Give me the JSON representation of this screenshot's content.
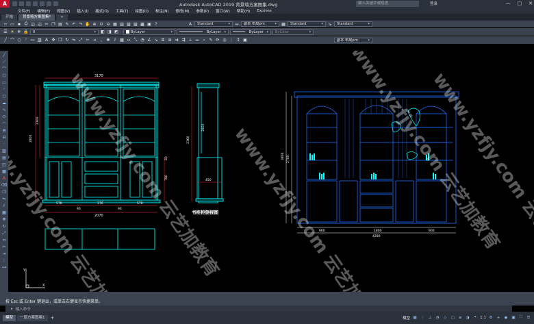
{
  "titlebar": {
    "logo": "A",
    "title": "Autodesk AutoCAD 2019    背景墙方案图集.dwg",
    "search_placeholder": "键入关键字或短语",
    "login": "登录",
    "minimize": "—",
    "maximize": "□",
    "close": "✕"
  },
  "menu": [
    "文件(F)",
    "编辑(E)",
    "视图(V)",
    "插入(I)",
    "格式(O)",
    "工具(T)",
    "绘图(D)",
    "标注(N)",
    "修改(M)",
    "参数(P)",
    "窗口(W)",
    "帮助(H)",
    "Express"
  ],
  "doc_tabs": [
    {
      "label": "开始",
      "active": false
    },
    {
      "label": "背景墙方案图集*",
      "active": true
    },
    {
      "label": "+",
      "active": false
    }
  ],
  "toolbar1": {
    "text_style": "Standard",
    "dim_layer": "副本 布局pm",
    "table_style": "Standard",
    "mleader_style": "Standard"
  },
  "toolbar2": {
    "layer_name": "0",
    "color": "ByLayer",
    "linetype": "ByLayer",
    "lineweight": "ByLayer",
    "plot_style": "ByColor"
  },
  "toolbar3": {
    "dim_style": "副本 布局pm"
  },
  "drawing": {
    "side_title": "书柜柜侧视图",
    "front_top_dim": "3170",
    "front_bottom_dims": [
      "570",
      "90",
      "376",
      "90",
      "570"
    ],
    "front_total_dim": "2070",
    "front_height_dims": [
      "2800",
      "2300",
      "780",
      "80"
    ],
    "side_height_dims": [
      "2360",
      "2800"
    ],
    "side_width_dim": "450",
    "right_height_dims": [
      "3800",
      "2700"
    ],
    "right_bottom_dims": [
      "900",
      "1800",
      "900"
    ],
    "right_total_dim": "4280"
  },
  "command": {
    "hint": "按 Esc 或 Enter 键退出，或单击右键显示快捷菜单。",
    "placeholder": "键入命令"
  },
  "layout_tabs": [
    {
      "label": "模型",
      "active": true
    },
    {
      "label": "一层方案图案1",
      "active": false
    }
  ],
  "status": {
    "model": "模型",
    "scale": "1:1"
  },
  "watermark": "www.yzfjy.com 云艺加教育",
  "colors": {
    "cyan": "#00ffff",
    "blue": "#1f6dff",
    "white": "#ffffff",
    "red": "#ff3030",
    "green": "#3cd23c",
    "magenta": "#ff40ff",
    "yellow": "#ffff40"
  }
}
